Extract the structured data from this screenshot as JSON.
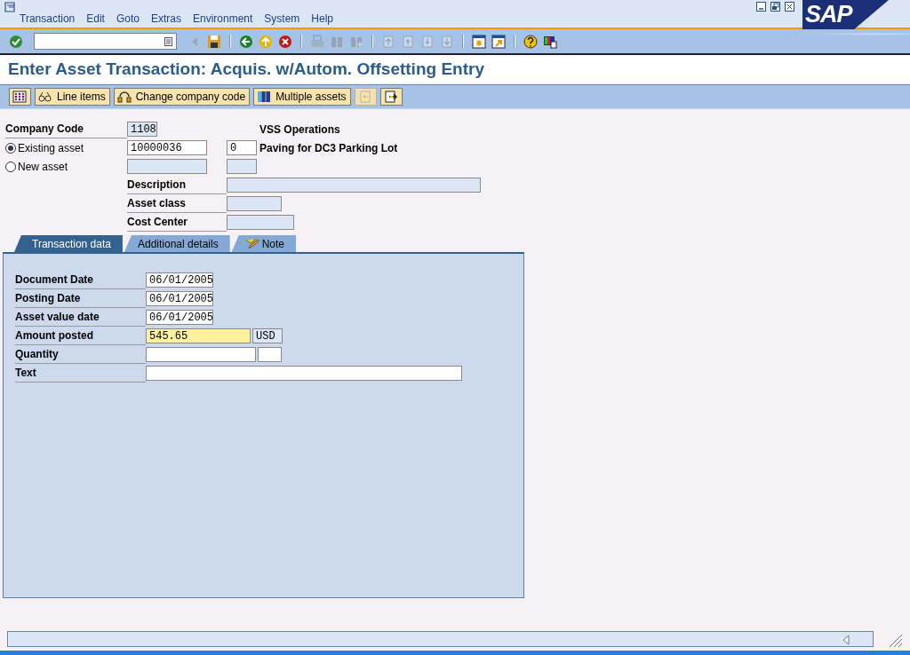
{
  "menu": [
    "Transaction",
    "Edit",
    "Goto",
    "Extras",
    "Environment",
    "System",
    "Help"
  ],
  "logo": "SAP",
  "system_toolbar": [
    {
      "disabled": false
    },
    {
      "disabled": false
    },
    {
      "disabled": false
    },
    {
      "disabled": false
    },
    {
      "disabled": false
    },
    {
      "disabled": false
    },
    {
      "disabled": true
    },
    {
      "disabled": true
    },
    {
      "disabled": true
    },
    {
      "disabled": true
    },
    {
      "disabled": true
    },
    {
      "disabled": true
    },
    {
      "disabled": true
    },
    {
      "disabled": false
    },
    {
      "disabled": false
    },
    {
      "disabled": false
    },
    {
      "disabled": false
    }
  ],
  "title": "Enter Asset Transaction: Acquis. w/Autom. Offsetting Entry",
  "app_toolbar": [
    {
      "kind": "icon",
      "disabled": false
    },
    {
      "kind": "labeled",
      "label": "Line items",
      "disabled": false
    },
    {
      "kind": "labeled",
      "label": "Change company code",
      "disabled": false
    },
    {
      "kind": "labeled",
      "label": "Multiple assets",
      "disabled": false
    },
    {
      "kind": "icon",
      "disabled": true
    },
    {
      "kind": "icon",
      "disabled": false
    }
  ],
  "company_code": {
    "label": "Company Code",
    "value": "1108",
    "name": "VSS Operations"
  },
  "asset_choice": [
    {
      "label": "Existing asset",
      "selected": true,
      "asset": "10000036",
      "sub_number": "0",
      "description": "Paving for DC3 Parking Lot"
    },
    {
      "label": "New asset",
      "selected": false
    }
  ],
  "new_asset_fields": [
    {
      "label": "Description",
      "kind": "long"
    },
    {
      "label": "Asset class",
      "kind": "short"
    },
    {
      "label": "Cost Center",
      "kind": "medium"
    }
  ],
  "tabs": [
    {
      "label": "Transaction data",
      "selected": true,
      "has_icon": false
    },
    {
      "label": "Additional details",
      "selected": false,
      "has_icon": false
    },
    {
      "label": "Note",
      "selected": false,
      "has_icon": true
    }
  ],
  "transaction_fields": [
    {
      "label": "Document Date",
      "kind": "date",
      "value": "06/01/2005",
      "focused": false
    },
    {
      "label": "Posting Date",
      "kind": "date",
      "value": "06/01/2005",
      "focused": false
    },
    {
      "label": "Asset value date",
      "kind": "date",
      "value": "06/01/2005",
      "focused": false
    },
    {
      "label": "Amount posted",
      "kind": "amount",
      "value": "545.65",
      "unit": "USD",
      "focused": true
    },
    {
      "label": "Quantity",
      "kind": "quantity",
      "focused": false
    },
    {
      "label": "Text",
      "kind": "text",
      "focused": false
    }
  ]
}
